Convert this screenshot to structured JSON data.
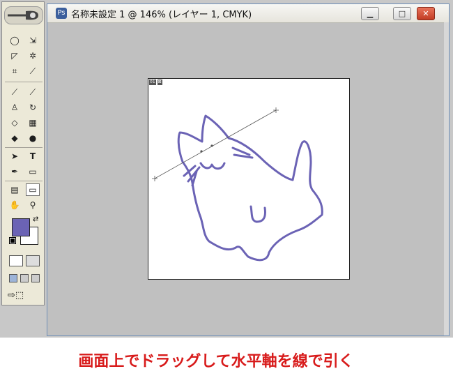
{
  "window": {
    "title": "名称未設定 1 @ 146% (レイヤー 1, CMYK)",
    "controls": [
      "minimize",
      "maximize",
      "close"
    ]
  },
  "canvas": {
    "badges": [
      "01",
      "⊠"
    ],
    "measure_line": {
      "from": "left",
      "to": "top-right",
      "color": "#555555"
    },
    "drawing": "cat sketch",
    "stroke_color": "#6b63b5"
  },
  "toolbox": {
    "tools": [
      "marquee-ellipse-icon",
      "move-select-icon",
      "lasso-icon",
      "magic-wand-icon",
      "crop-icon",
      "eyedropper-icon",
      "bandage-icon",
      "brush-icon",
      "stamp-icon",
      "history-brush-icon",
      "eraser-icon",
      "gradient-icon",
      "blur-icon",
      "dodge-icon",
      "path-select-icon",
      "type-icon",
      "pen-icon",
      "shape-icon",
      "notes-icon",
      "measure-icon",
      "hand-icon",
      "zoom-icon"
    ],
    "active_tool": "measure-icon",
    "foreground_color": "#6b63b5",
    "background_color": "#ffffff"
  },
  "caption": "画面上でドラッグして水平軸を線で引く"
}
